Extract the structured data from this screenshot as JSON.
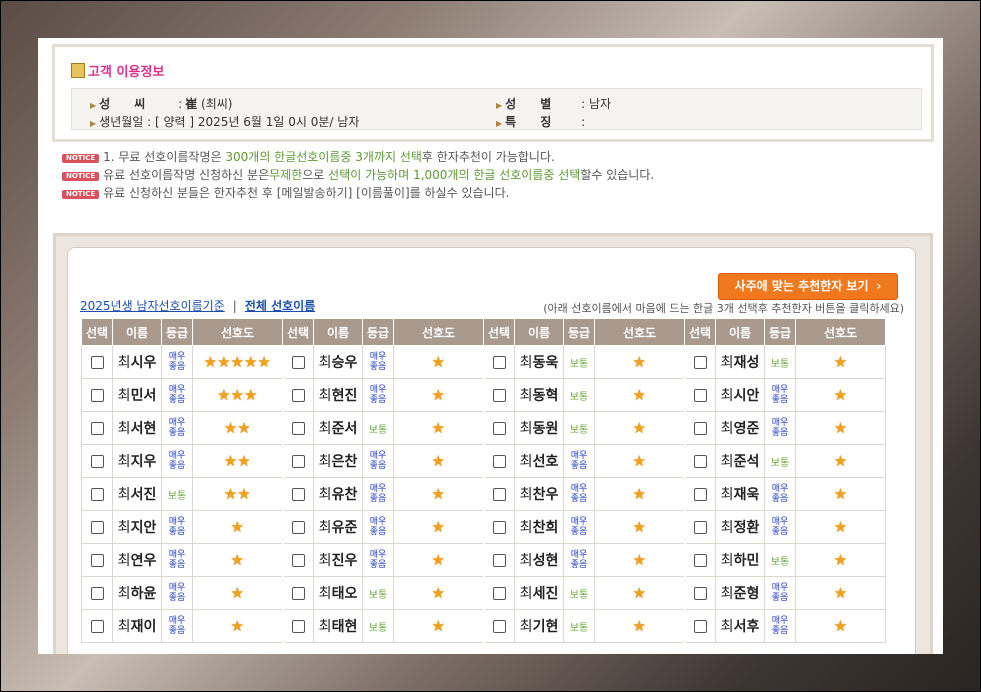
{
  "customer": {
    "title": "고객 이용정보",
    "surname_label": "성　　씨",
    "surname_value": "崔",
    "surname_reading": "(최씨)",
    "gender_label": "성　　별",
    "gender_value": ": 남자",
    "birth_label": "생년월일",
    "birth_value": ": [ 양력 ] 2025년 6월 1일 0시 0분/ 남자",
    "feature_label": "특　　징",
    "feature_value": ":"
  },
  "notice_badge": "NOTICE",
  "notices": [
    {
      "a": "1. 무료 선호이름작명은 ",
      "b": "300개의 한글선호이름중 3개까지 선택",
      "c": "후 한자추천이 가능합니다.",
      "d": "",
      "e": ""
    },
    {
      "a": "유료 선호이름작명 신청하신 분은",
      "b": "무제한",
      "c": "으로 ",
      "d": "선택이 가능하며 1,000개의 한글 선호이름중 선택",
      "e": "할수 있습니다."
    },
    {
      "a": "유료 신청하신 분들은 한자추천 후 [메일발송하기] [이름풀이]를 하실수 있습니다.",
      "b": "",
      "c": "",
      "d": "",
      "e": ""
    }
  ],
  "toolbar": {
    "recommend_button": "사주에 맞는 추천한자 보기",
    "tab_year": "2025년생 남자선호이름기준",
    "tab_separator": "|",
    "tab_all": "전체 선호이름",
    "hint": "(아래 선호이름에서 마음에 드는 한글 3개 선택후 추천한자 버튼을 클릭하세요)"
  },
  "table": {
    "headers": [
      "선택",
      "이름",
      "등급",
      "선호도"
    ],
    "surname": "최",
    "rows": [
      [
        {
          "n": "시우",
          "g": "매우좋음",
          "s": 5
        },
        {
          "n": "승우",
          "g": "매우좋음",
          "s": 1
        },
        {
          "n": "동욱",
          "g": "보통",
          "s": 1
        },
        {
          "n": "재성",
          "g": "보통",
          "s": 1
        }
      ],
      [
        {
          "n": "민서",
          "g": "매우좋음",
          "s": 3
        },
        {
          "n": "현진",
          "g": "매우좋음",
          "s": 1
        },
        {
          "n": "동혁",
          "g": "보통",
          "s": 1
        },
        {
          "n": "시안",
          "g": "매우좋음",
          "s": 1
        }
      ],
      [
        {
          "n": "서현",
          "g": "매우좋음",
          "s": 2
        },
        {
          "n": "준서",
          "g": "보통",
          "s": 1
        },
        {
          "n": "동원",
          "g": "보통",
          "s": 1
        },
        {
          "n": "영준",
          "g": "매우좋음",
          "s": 1
        }
      ],
      [
        {
          "n": "지우",
          "g": "매우좋음",
          "s": 2
        },
        {
          "n": "은찬",
          "g": "매우좋음",
          "s": 1
        },
        {
          "n": "선호",
          "g": "매우좋음",
          "s": 1
        },
        {
          "n": "준석",
          "g": "보통",
          "s": 1
        }
      ],
      [
        {
          "n": "서진",
          "g": "보통",
          "s": 2
        },
        {
          "n": "유찬",
          "g": "매우좋음",
          "s": 1
        },
        {
          "n": "찬우",
          "g": "매우좋음",
          "s": 1
        },
        {
          "n": "재욱",
          "g": "매우좋음",
          "s": 1
        }
      ],
      [
        {
          "n": "지안",
          "g": "매우좋음",
          "s": 1
        },
        {
          "n": "유준",
          "g": "매우좋음",
          "s": 1
        },
        {
          "n": "찬희",
          "g": "매우좋음",
          "s": 1
        },
        {
          "n": "정환",
          "g": "매우좋음",
          "s": 1
        }
      ],
      [
        {
          "n": "연우",
          "g": "매우좋음",
          "s": 1
        },
        {
          "n": "진우",
          "g": "매우좋음",
          "s": 1
        },
        {
          "n": "성현",
          "g": "매우좋음",
          "s": 1
        },
        {
          "n": "하민",
          "g": "보통",
          "s": 1
        }
      ],
      [
        {
          "n": "하윤",
          "g": "매우좋음",
          "s": 1
        },
        {
          "n": "태오",
          "g": "보통",
          "s": 1
        },
        {
          "n": "세진",
          "g": "보통",
          "s": 1
        },
        {
          "n": "준형",
          "g": "매우좋음",
          "s": 1
        }
      ],
      [
        {
          "n": "재이",
          "g": "매우좋음",
          "s": 1
        },
        {
          "n": "태현",
          "g": "보통",
          "s": 1
        },
        {
          "n": "기현",
          "g": "보통",
          "s": 1
        },
        {
          "n": "서후",
          "g": "매우좋음",
          "s": 1
        }
      ]
    ]
  }
}
